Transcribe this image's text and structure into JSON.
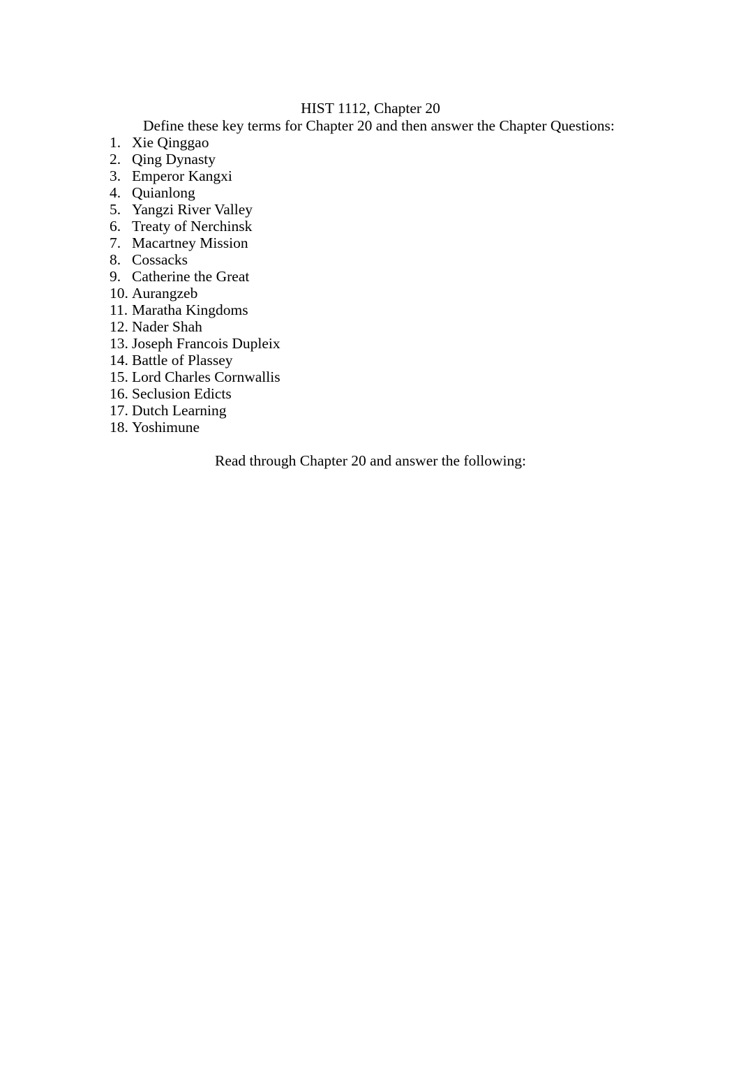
{
  "document": {
    "title": "HIST 1112, Chapter 20",
    "instruction": "Define these key terms for Chapter 20 and then answer the Chapter Questions:",
    "closing": "Read through Chapter 20 and answer the following:",
    "background_color": "#ffffff",
    "text_color": "#000000",
    "key_terms": [
      {
        "number": "1.",
        "label": "Xie Qinggao"
      },
      {
        "number": "2.",
        "label": "Qing Dynasty"
      },
      {
        "number": "3.",
        "label": "Emperor Kangxi"
      },
      {
        "number": "4.",
        "label": "Quianlong"
      },
      {
        "number": "5.",
        "label": "Yangzi River Valley"
      },
      {
        "number": "6.",
        "label": "Treaty of Nerchinsk"
      },
      {
        "number": "7.",
        "label": "Macartney Mission"
      },
      {
        "number": "8.",
        "label": "Cossacks"
      },
      {
        "number": "9.",
        "label": "Catherine the Great"
      },
      {
        "number": "10.",
        "label": "Aurangzeb"
      },
      {
        "number": "11.",
        "label": "Maratha Kingdoms"
      },
      {
        "number": "12.",
        "label": "Nader Shah"
      },
      {
        "number": "13.",
        "label": "Joseph Francois Dupleix"
      },
      {
        "number": "14.",
        "label": "Battle of Plassey"
      },
      {
        "number": "15.",
        "label": "Lord Charles Cornwallis"
      },
      {
        "number": "16.",
        "label": "Seclusion Edicts"
      },
      {
        "number": "17.",
        "label": "Dutch Learning"
      },
      {
        "number": "18.",
        "label": "Yoshimune"
      }
    ]
  }
}
